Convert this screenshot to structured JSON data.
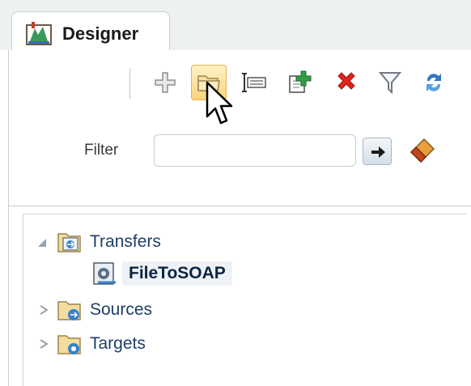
{
  "tabs": [
    {
      "label": "Designer",
      "icon": "designer-icon",
      "active": true
    }
  ],
  "toolbar": {
    "buttons": [
      {
        "name": "add-icon",
        "tooltip": "Add"
      },
      {
        "name": "folder-icon",
        "tooltip": "New Folder",
        "state": "hover"
      },
      {
        "name": "rename-icon",
        "tooltip": "Rename"
      },
      {
        "name": "copy-add-icon",
        "tooltip": "Duplicate"
      },
      {
        "name": "delete-icon",
        "tooltip": "Delete"
      },
      {
        "name": "filter-icon",
        "tooltip": "Filter"
      },
      {
        "name": "refresh-icon",
        "tooltip": "Refresh"
      }
    ]
  },
  "filter": {
    "label": "Filter",
    "value": "",
    "placeholder": "",
    "go_icon": "arrow-right-icon",
    "clear_icon": "eraser-icon"
  },
  "tree": {
    "nodes": [
      {
        "label": "Transfers",
        "expanded": true,
        "icon": "transfers-folder-icon"
      },
      {
        "label": "FileToSOAP",
        "selected": true,
        "icon": "transfer-item-icon",
        "parent": "Transfers"
      },
      {
        "label": "Sources",
        "expanded": false,
        "icon": "sources-folder-icon"
      },
      {
        "label": "Targets",
        "expanded": false,
        "icon": "targets-folder-icon"
      }
    ]
  },
  "colors": {
    "hover_bg": "#fbd37a",
    "delete_red": "#e2231a",
    "label_blue": "#1f3f66",
    "plus_green": "#2f9e44",
    "refresh_blue": "#2f78c4"
  }
}
